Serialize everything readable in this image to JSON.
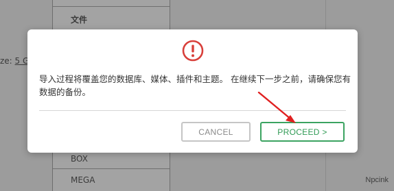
{
  "background": {
    "panel_item_top": "文件",
    "panel_item_box": "BOX",
    "panel_item_mega": "MEGA",
    "size_label": "ze: ",
    "size_value": "5 G",
    "brand": "Npcink"
  },
  "modal": {
    "icon": "warning-circle-icon",
    "message": "导入过程将覆盖您的数据库、媒体、插件和主题。 在继续下一步之前，请确保您有数据的备份。",
    "cancel_label": "CANCEL",
    "proceed_label": "PROCEED >"
  },
  "colors": {
    "warning": "#d83f3a",
    "proceed": "#3aa360",
    "cancel_border": "#c5c5c5",
    "annotation_arrow": "#e02020"
  }
}
